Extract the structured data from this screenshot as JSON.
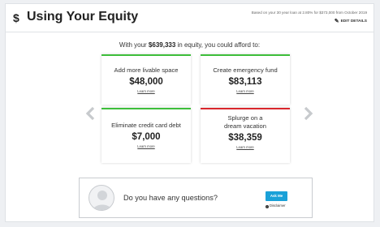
{
  "header": {
    "currency_symbol": "$",
    "title": "Using Your Equity",
    "basis_note": "Based on your 30 year loan at 2.80% for $373,000 from October 2019",
    "edit_label": "EDIT DETAILS"
  },
  "headline": {
    "prefix": "With your ",
    "equity": "$639,333",
    "suffix": " in equity, you could afford to:"
  },
  "tiles": [
    {
      "name": "Add more livable space",
      "amount": "$48,000",
      "link": "Learn more",
      "accent": "#3dbe3a"
    },
    {
      "name": "Create emergency fund",
      "amount": "$83,113",
      "link": "Learn more",
      "accent": "#3dbe3a"
    },
    {
      "name": "Eliminate credit card debt",
      "amount": "$7,000",
      "link": "Learn more",
      "accent": "#3dbe3a"
    },
    {
      "name": "Splurge on a dream vacation",
      "amount": "$38,359",
      "link": "Learn more",
      "accent": "#d9262c"
    }
  ],
  "carousel": {
    "prev_icon": "chevron-left-icon",
    "next_icon": "chevron-right-icon",
    "arrow_color": "#c7cacd"
  },
  "question_box": {
    "text": "Do you have any questions?",
    "ask_button": "Ask Me",
    "disclaimer": "Disclaimer",
    "button_color": "#1aa1d8"
  }
}
